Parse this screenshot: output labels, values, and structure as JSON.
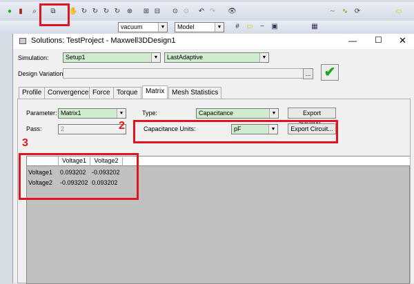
{
  "toolbar": {
    "material_select": "vacuum",
    "model_select": "Model"
  },
  "dialog": {
    "title": "Solutions: TestProject - Maxwell3DDesign1",
    "simulation_label": "Simulation:",
    "simulation_value": "Setup1",
    "solution_value": "LastAdaptive",
    "design_variation_label": "Design Variation:",
    "ellipsis_label": "...",
    "tabs": [
      "Profile",
      "Convergence",
      "Force",
      "Torque",
      "Matrix",
      "Mesh Statistics"
    ],
    "active_tab": "Matrix",
    "parameter_label": "Parameter:",
    "parameter_value": "Matrix1",
    "pass_label": "Pass:",
    "pass_value": "2",
    "type_label": "Type:",
    "type_value": "Capacitance",
    "units_label": "Capacitance Units:",
    "units_value": "pF",
    "export_solution": "Export Solution...",
    "export_circuit": "Export Circuit...",
    "table": {
      "columns": [
        "Voltage1",
        "Voltage2"
      ],
      "rows": [
        {
          "name": "Voltage1",
          "values": [
            "0.093202",
            "-0.093202"
          ]
        },
        {
          "name": "Voltage2",
          "values": [
            "-0.093202",
            "0.093202"
          ]
        }
      ]
    }
  },
  "annotations": {
    "step2": "2",
    "step3": "3"
  },
  "colors": {
    "highlight": "#e0141e",
    "field_green": "#cfeccf",
    "check_green": "#1fa81f"
  }
}
